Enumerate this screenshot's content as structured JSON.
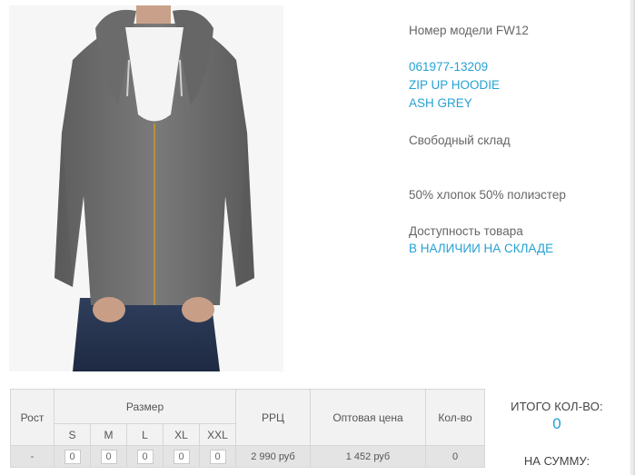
{
  "product": {
    "model_line": "Номер модели FW12",
    "article": "061977-13209",
    "name": "ZIP UP HOODIE",
    "color": "ASH GREY",
    "warehouse": "Свободный склад",
    "composition": "50% хлопок 50% полиэстер",
    "availability_label": "Доступность товара",
    "availability_value": "В НАЛИЧИИ НА СКЛАДЕ",
    "image_alt": "Серое худи на молнии"
  },
  "table": {
    "col_height": "Рост",
    "col_size": "Размер",
    "col_rrp": "РРЦ",
    "col_wholesale": "Оптовая цена",
    "col_qty": "Кол-во",
    "sizes": [
      "S",
      "M",
      "L",
      "XL",
      "XXL"
    ],
    "row": {
      "height": "-",
      "quantities": [
        "0",
        "0",
        "0",
        "0",
        "0"
      ],
      "rrp": "2 990 руб",
      "wholesale": "1 452 руб",
      "qty": "0"
    }
  },
  "totals": {
    "total_qty_label": "ИТОГО КОЛ-ВО:",
    "total_qty_value": "0",
    "total_sum_label": "НА СУММУ:"
  },
  "colors": {
    "accent": "#27a1d4",
    "text": "#555555",
    "table_bg": "#f2f2f2",
    "table_row_bg": "#e4e4e4"
  }
}
